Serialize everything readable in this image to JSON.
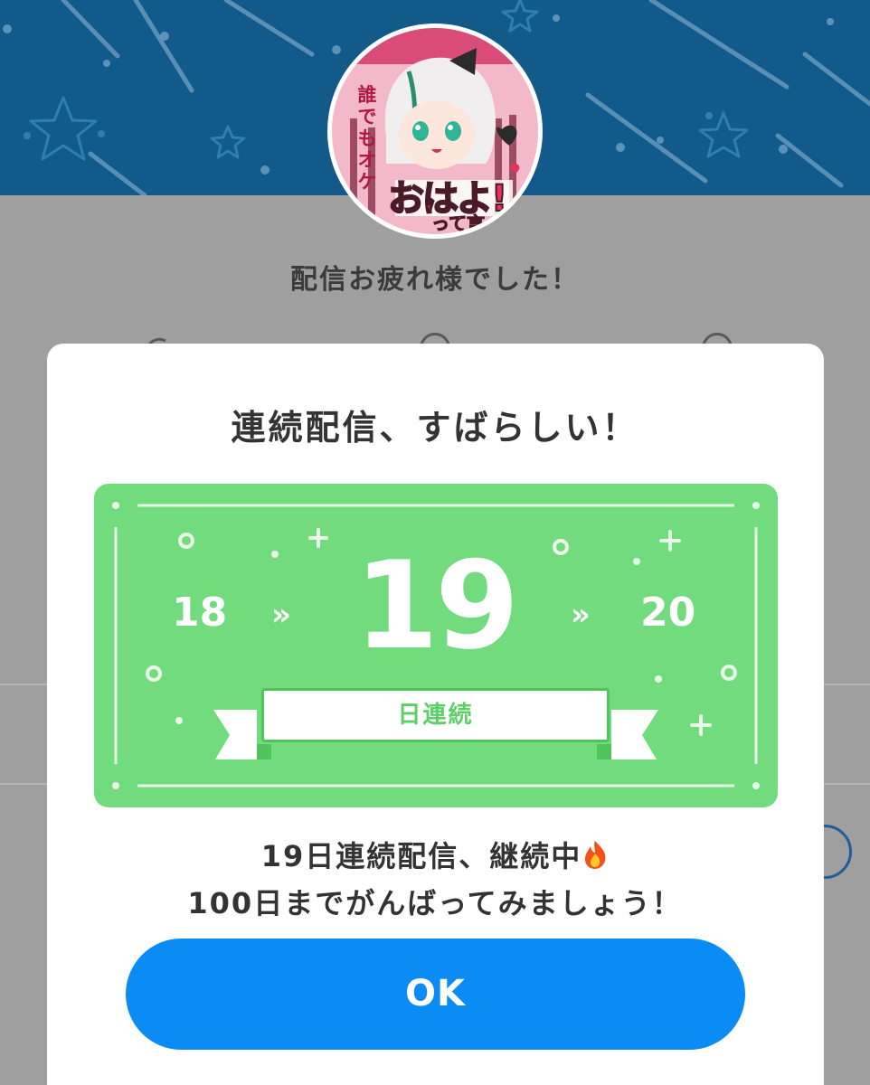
{
  "background_page": {
    "title": "配信お疲れ様でした！"
  },
  "avatar": {
    "vertical_text": "誰でもオケ",
    "big_text": "おはよ!",
    "small_text": "って言っ"
  },
  "modal": {
    "title": "連続配信、すばらしい！",
    "streak": {
      "previous": "18",
      "current": "19",
      "next": "20",
      "label": "日連続"
    },
    "message_line1": "19日連続配信、継続中",
    "message_line2": "100日までがんばってみましょう！",
    "ok_label": "OK"
  },
  "colors": {
    "header_blue": "#115a8a",
    "ticket_green": "#72db7d",
    "ok_blue": "#0b8cf5"
  }
}
